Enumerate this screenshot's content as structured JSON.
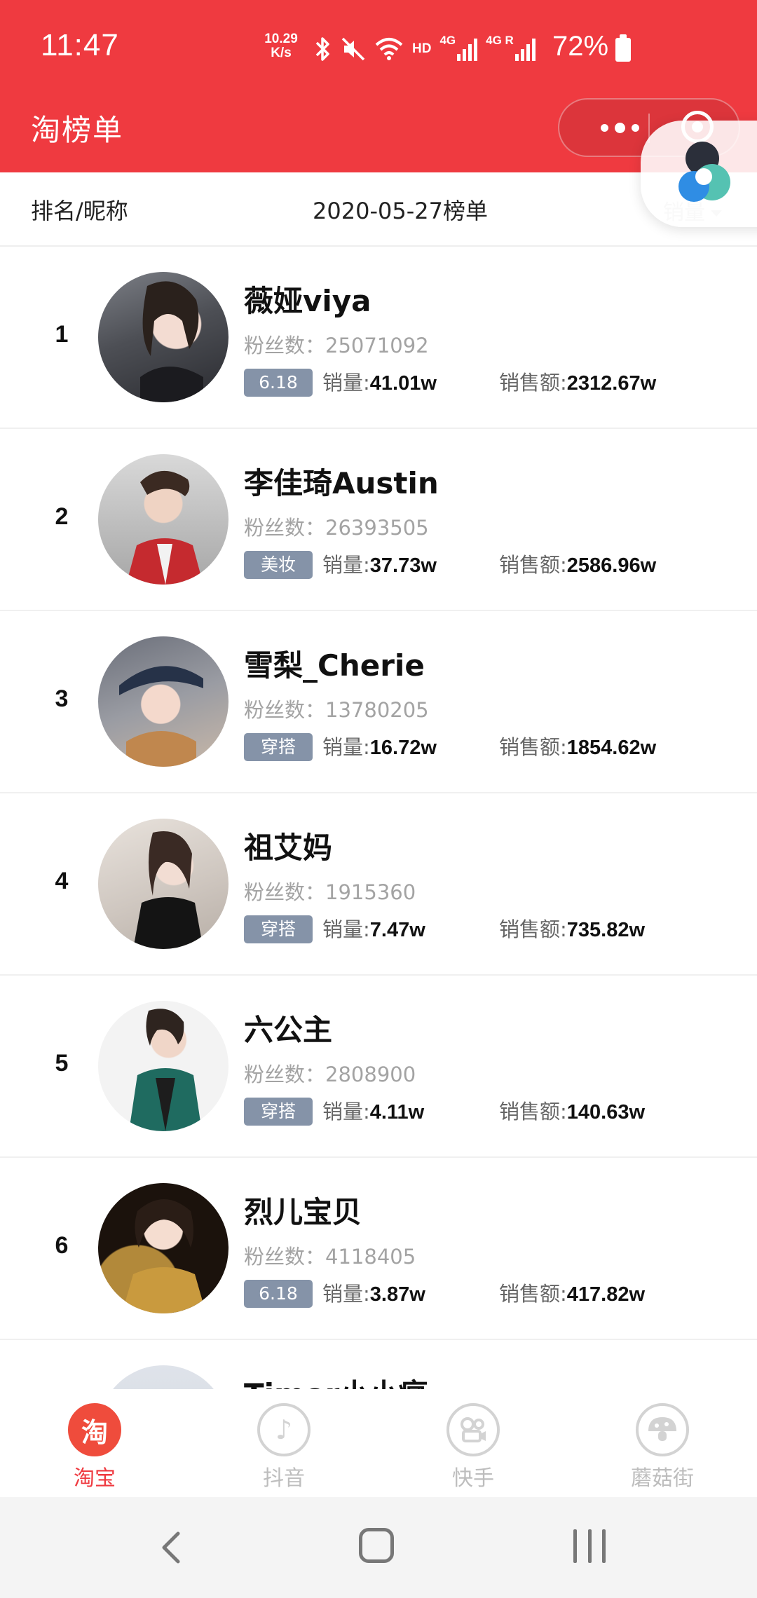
{
  "status_bar": {
    "time": "11:47",
    "net_speed_value": "10.29",
    "net_speed_unit": "K/s",
    "hd_label": "HD",
    "sim1_label": "4G",
    "sim2_label": "4G R",
    "battery_percent": "72%"
  },
  "header": {
    "title": "淘榜单"
  },
  "column_header": {
    "rank_name": "排名/昵称",
    "date_label": "2020-05-27榜单",
    "sort_label": "销量"
  },
  "labels": {
    "fans": "粉丝数：",
    "sales": "销量:",
    "amount": "销售额:"
  },
  "anchors": [
    {
      "rank": "1",
      "name": "薇娅viya",
      "fans": "25071092",
      "tag": "6.18",
      "sales": "41.01w",
      "amount": "2312.67w"
    },
    {
      "rank": "2",
      "name": "李佳琦Austin",
      "fans": "26393505",
      "tag": "美妆",
      "sales": "37.73w",
      "amount": "2586.96w"
    },
    {
      "rank": "3",
      "name": "雪梨_Cherie",
      "fans": "13780205",
      "tag": "穿搭",
      "sales": "16.72w",
      "amount": "1854.62w"
    },
    {
      "rank": "4",
      "name": "祖艾妈",
      "fans": "1915360",
      "tag": "穿搭",
      "sales": "7.47w",
      "amount": "735.82w"
    },
    {
      "rank": "5",
      "name": "六公主",
      "fans": "2808900",
      "tag": "穿搭",
      "sales": "4.11w",
      "amount": "140.63w"
    },
    {
      "rank": "6",
      "name": "烈儿宝贝",
      "fans": "4118405",
      "tag": "6.18",
      "sales": "3.87w",
      "amount": "417.82w"
    },
    {
      "rank": "",
      "name": "Timor小小瘋",
      "fans": "",
      "tag": "",
      "sales": "",
      "amount": ""
    }
  ],
  "tabs": [
    {
      "label": "淘宝",
      "glyph": "淘",
      "icon": "taobao-icon",
      "active": true
    },
    {
      "label": "抖音",
      "glyph": "♪",
      "icon": "douyin-icon",
      "active": false
    },
    {
      "label": "快手",
      "glyph": "",
      "icon": "kuaishou-icon",
      "active": false
    },
    {
      "label": "蘑菇街",
      "glyph": "",
      "icon": "mogujie-icon",
      "active": false
    }
  ],
  "theme": {
    "brand_red": "#ef3a40",
    "tag_bg": "#8593a8"
  }
}
